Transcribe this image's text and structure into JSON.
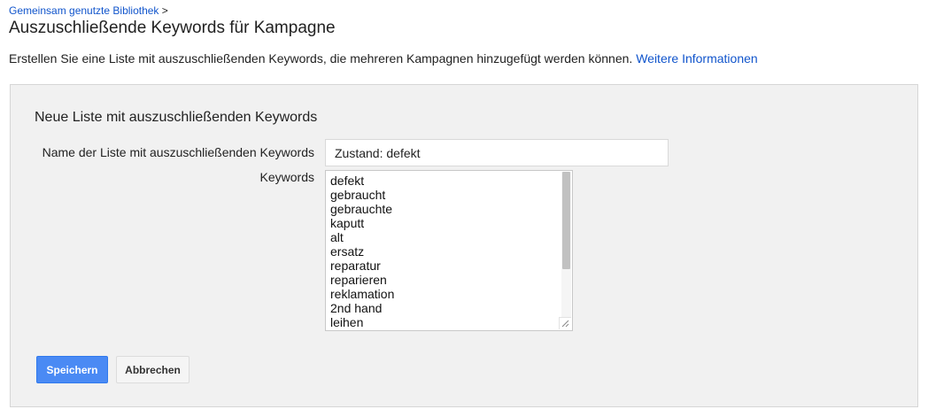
{
  "breadcrumb": {
    "link": "Gemeinsam genutzte Bibliothek",
    "separator": ">"
  },
  "page": {
    "title": "Auszuschließende Keywords für Kampagne",
    "intro": "Erstellen Sie eine Liste mit auszuschließenden Keywords, die mehreren Kampagnen hinzugefügt werden können.",
    "more_info_link": "Weitere Informationen"
  },
  "form": {
    "section_title": "Neue Liste mit auszuschließenden Keywords",
    "name_label": "Name der Liste mit auszuschließenden Keywords",
    "name_value": "Zustand: defekt",
    "keywords_label": "Keywords",
    "keywords": [
      "defekt",
      "gebraucht",
      "gebrauchte",
      "kaputt",
      "alt",
      "ersatz",
      "reparatur",
      "reparieren",
      "reklamation",
      "2nd hand",
      "leihen"
    ]
  },
  "buttons": {
    "save": "Speichern",
    "cancel": "Abbrechen"
  },
  "colors": {
    "link": "#1155cc",
    "primary_button": "#4a8af4",
    "panel_background": "#f1f1f1"
  }
}
